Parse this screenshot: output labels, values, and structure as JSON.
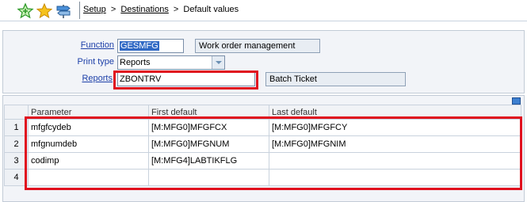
{
  "toolbar": {
    "icons": [
      "add-favorite-icon",
      "favorites-star-icon",
      "signpost-icon"
    ]
  },
  "breadcrumb": {
    "items": [
      "Setup",
      "Destinations"
    ],
    "separator": ">",
    "current": "Default values"
  },
  "form": {
    "function_label": "Function",
    "function_value": "GESMFG",
    "function_desc": "Work order management",
    "print_type_label": "Print type",
    "print_type_value": "Reports",
    "reports_label": "Reports",
    "reports_value": "ZBONTRV",
    "reports_desc": "Batch Ticket"
  },
  "grid": {
    "headers": [
      "",
      "Parameter",
      "First default",
      "Last default"
    ],
    "rows": [
      {
        "n": "1",
        "parameter": "mfgfcydeb",
        "first": "[M:MFG0]MFGFCX",
        "last": "[M:MFG0]MFGFCY"
      },
      {
        "n": "2",
        "parameter": "mfgnumdeb",
        "first": "[M:MFG0]MFGNUM",
        "last": "[M:MFG0]MFGNIM"
      },
      {
        "n": "3",
        "parameter": "codimp",
        "first": "[M:MFG4]LABTIKFLG",
        "last": ""
      },
      {
        "n": "4",
        "parameter": "",
        "first": "",
        "last": ""
      }
    ]
  },
  "colors": {
    "highlight": "#e0101e",
    "link": "#1c3fa8",
    "panel": "#f2f4f8"
  }
}
